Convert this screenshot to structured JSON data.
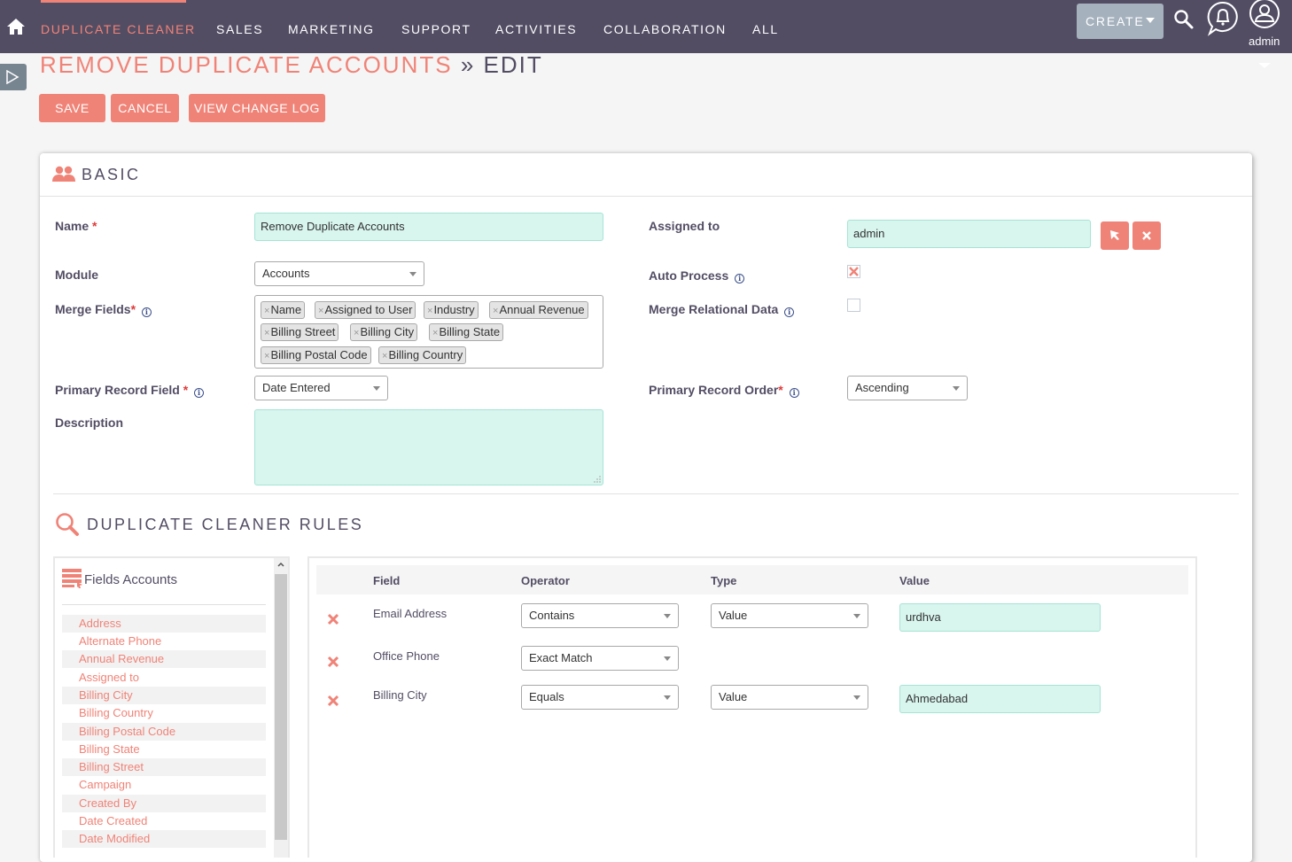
{
  "nav": {
    "home_label": "Home",
    "items": [
      {
        "label": "DUPLICATE CLEANER",
        "active": true
      },
      {
        "label": "SALES"
      },
      {
        "label": "MARKETING"
      },
      {
        "label": "SUPPORT"
      },
      {
        "label": "ACTIVITIES"
      },
      {
        "label": "COLLABORATION"
      },
      {
        "label": "ALL"
      }
    ],
    "create_label": "CREATE",
    "user_label": "admin",
    "accent_color": "#f08377",
    "bar_color": "#534d64"
  },
  "page": {
    "title_module": "REMOVE DUPLICATE ACCOUNTS",
    "title_separator": "»",
    "title_action": "EDIT"
  },
  "actions": {
    "save": "SAVE",
    "cancel": "CANCEL",
    "change_log": "VIEW CHANGE LOG"
  },
  "basic": {
    "section_title": "BASIC",
    "name": {
      "label": "Name",
      "required": "*",
      "value": "Remove Duplicate Accounts"
    },
    "module": {
      "label": "Module",
      "value": "Accounts"
    },
    "merge_fields": {
      "label": "Merge Fields",
      "required": "*",
      "tags": [
        "Name",
        "Assigned to User",
        "Industry",
        "Annual Revenue",
        "Billing Street",
        "Billing City",
        "Billing State",
        "Billing Postal Code",
        "Billing Country"
      ]
    },
    "primary_record_field": {
      "label": "Primary Record Field",
      "required": "*",
      "value": "Date Entered"
    },
    "description": {
      "label": "Description",
      "value": ""
    },
    "assigned_to": {
      "label": "Assigned to",
      "value": "admin"
    },
    "auto_process": {
      "label": "Auto Process",
      "checked": true
    },
    "merge_relational": {
      "label": "Merge Relational Data",
      "checked": false
    },
    "primary_record_order": {
      "label": "Primary Record Order",
      "required": "*",
      "value": "Ascending"
    },
    "tag_remove_glyph": "×",
    "info_glyph": "i"
  },
  "rules": {
    "section_title": "DUPLICATE CLEANER RULES",
    "fields_panel": {
      "title": "Fields Accounts",
      "items": [
        "Address",
        "Alternate Phone",
        "Annual Revenue",
        "Assigned to",
        "Billing City",
        "Billing Country",
        "Billing Postal Code",
        "Billing State",
        "Billing Street",
        "Campaign",
        "Created By",
        "Date Created",
        "Date Modified"
      ]
    },
    "columns": [
      "Field",
      "Operator",
      "Type",
      "Value"
    ],
    "rows": [
      {
        "field": "Email Address",
        "operator": "Contains",
        "type": "Value",
        "value": "urdhva"
      },
      {
        "field": "Office Phone",
        "operator": "Exact Match",
        "type": null,
        "value": null
      },
      {
        "field": "Billing City",
        "operator": "Equals",
        "type": "Value",
        "value": "Ahmedabad"
      }
    ]
  }
}
